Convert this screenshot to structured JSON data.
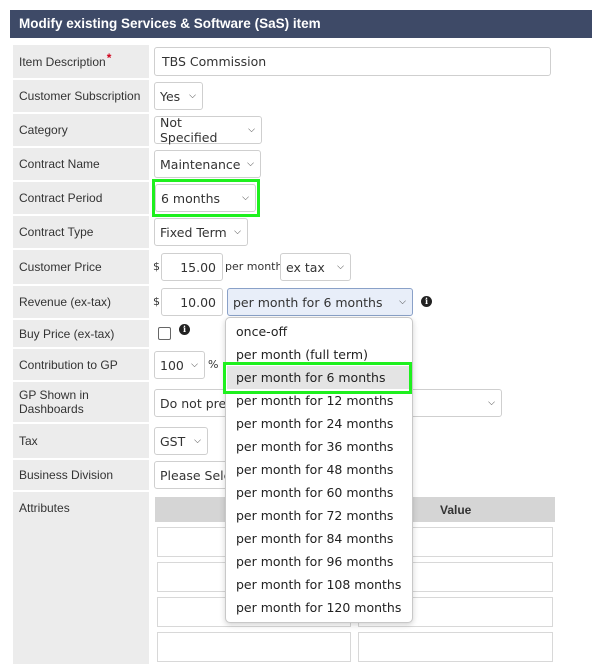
{
  "header": {
    "title": "Modify existing Services & Software (SaS) item"
  },
  "form": {
    "item_description": {
      "label": "Item Description",
      "required_mark": "*",
      "value": "TBS Commission"
    },
    "customer_subscription": {
      "label": "Customer Subscription",
      "value": "Yes"
    },
    "category": {
      "label": "Category",
      "value": "Not Specified"
    },
    "contract_name": {
      "label": "Contract Name",
      "value": "Maintenance"
    },
    "contract_period": {
      "label": "Contract Period",
      "value": "6 months"
    },
    "contract_type": {
      "label": "Contract Type",
      "value": "Fixed Term"
    },
    "customer_price": {
      "label": "Customer Price",
      "currency": "$",
      "value": "15.00",
      "unit": "per month",
      "tax_mode": "ex tax"
    },
    "revenue": {
      "label": "Revenue (ex-tax)",
      "currency": "$",
      "value": "10.00",
      "period": "per month for 6 months"
    },
    "buy_price": {
      "label": "Buy Price (ex-tax)",
      "checked": false
    },
    "contribution": {
      "label": "Contribution to GP",
      "value": "100",
      "unit": "%"
    },
    "gp_dashboards": {
      "label_line1": "GP Shown in",
      "label_line2": "Dashboards",
      "value": "Do not pres"
    },
    "tax": {
      "label": "Tax",
      "value": "GST"
    },
    "business_division": {
      "label": "Business Division",
      "value": "Please Sele"
    },
    "attributes": {
      "label": "Attributes",
      "value_header": "Value"
    }
  },
  "dropdown": {
    "options": [
      "once-off",
      "per month (full term)",
      "per month for 6 months",
      "per month for 12 months",
      "per month for 24 months",
      "per month for 36 months",
      "per month for 48 months",
      "per month for 60 months",
      "per month for 72 months",
      "per month for 84 months",
      "per month for 96 months",
      "per month for 108 months",
      "per month for 120 months"
    ],
    "selected": "per month for 6 months"
  },
  "colors": {
    "header_bg": "#3e4a67",
    "highlight": "#1ef01e",
    "label_bg": "#ececec",
    "select_focus": "#e8eef9"
  },
  "icons": {
    "chevron": "chevron-down-icon",
    "info": "info-icon"
  }
}
